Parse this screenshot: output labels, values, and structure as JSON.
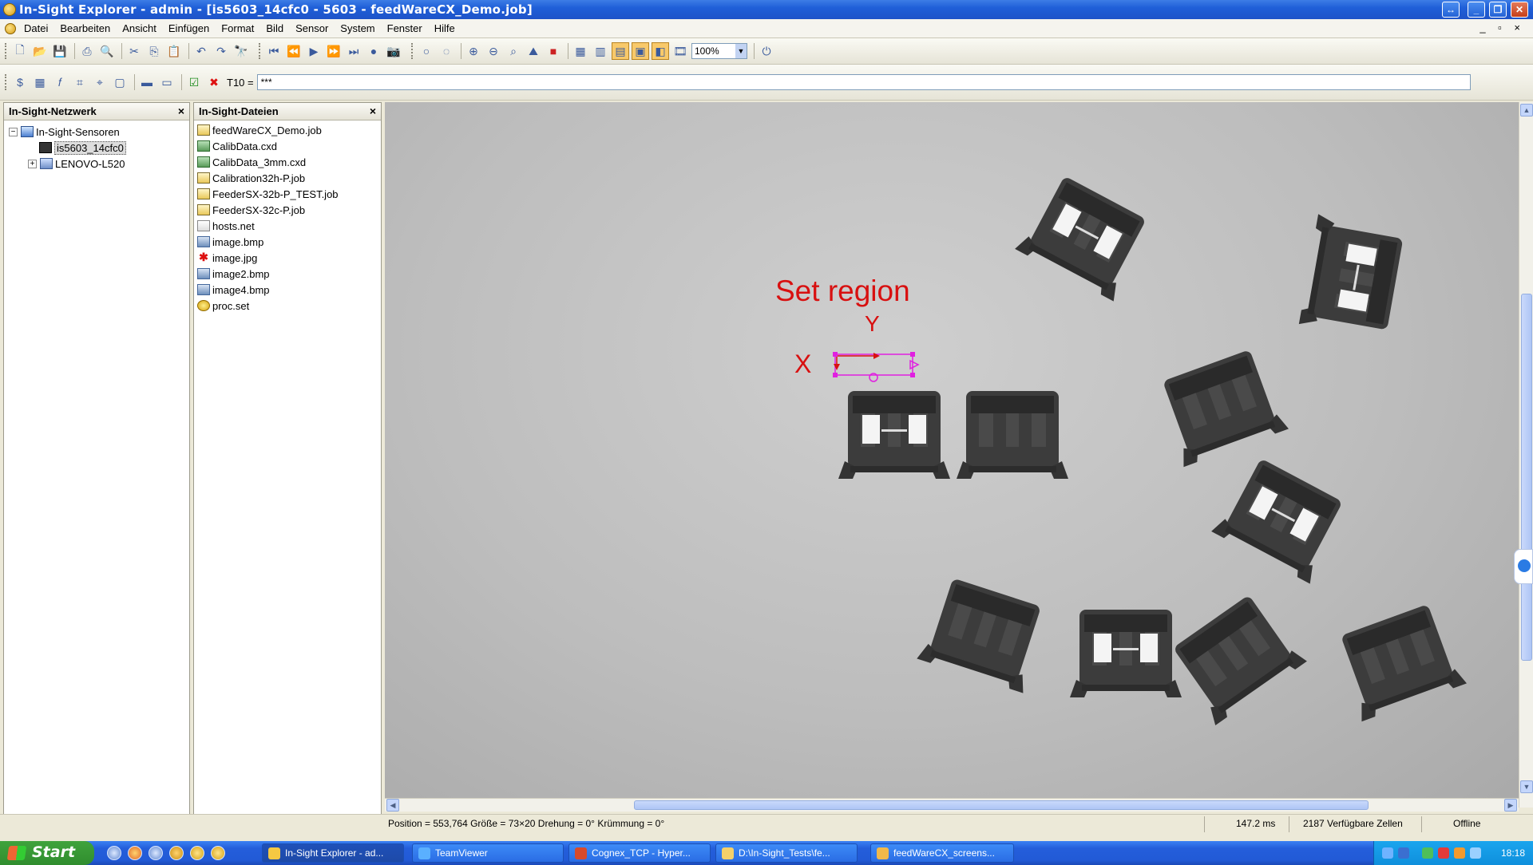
{
  "window": {
    "title": "In-Sight Explorer - admin - [is5603_14cfc0 - 5603 - feedWareCX_Demo.job]"
  },
  "menu": {
    "items": [
      "Datei",
      "Bearbeiten",
      "Ansicht",
      "Einfügen",
      "Format",
      "Bild",
      "Sensor",
      "System",
      "Fenster",
      "Hilfe"
    ],
    "mdi_controls": "_ ▫ ×"
  },
  "toolbar": {
    "zoom_value": "100%",
    "formula_label": "T10 =",
    "formula_value": "***"
  },
  "network_panel": {
    "title": "In-Sight-Netzwerk",
    "root": "In-Sight-Sensoren",
    "children": [
      "is5603_14cfc0",
      "LENOVO-L520"
    ]
  },
  "files_panel": {
    "title": "In-Sight-Dateien",
    "files": [
      {
        "name": "feedWareCX_Demo.job",
        "icon": "job-file-icon"
      },
      {
        "name": "CalibData.cxd",
        "icon": "cxd-file-icon"
      },
      {
        "name": "CalibData_3mm.cxd",
        "icon": "cxd-file-icon"
      },
      {
        "name": "Calibration32h-P.job",
        "icon": "job-file-icon"
      },
      {
        "name": "FeederSX-32b-P_TEST.job",
        "icon": "job-file-icon"
      },
      {
        "name": "FeederSX-32c-P.job",
        "icon": "job-file-icon"
      },
      {
        "name": "hosts.net",
        "icon": "net-file-icon"
      },
      {
        "name": "image.bmp",
        "icon": "bmp-file-icon"
      },
      {
        "name": "image.jpg",
        "icon": "jpg-file-icon"
      },
      {
        "name": "image2.bmp",
        "icon": "bmp-file-icon"
      },
      {
        "name": "image4.bmp",
        "icon": "bmp-file-icon"
      },
      {
        "name": "proc.set",
        "icon": "set-file-icon"
      }
    ]
  },
  "viewer": {
    "annotation": "Set region",
    "axis_x": "X",
    "axis_y": "Y",
    "colors": {
      "annotation": "#d81010",
      "region": "#e020e0"
    }
  },
  "status": {
    "position_text": "Position = 553,764 Größe = 73×20 Drehung = 0° Krümmung = 0°",
    "time": "147.2 ms",
    "cells": "2187 Verfügbare Zellen",
    "mode": "Offline"
  },
  "taskbar": {
    "start": "Start",
    "tasks": [
      "In-Sight Explorer - ad...",
      "TeamViewer",
      "Cognex_TCP - Hyper...",
      "D:\\In-Sight_Tests\\fe...",
      "feedWareCX_screens..."
    ],
    "clock": "18:18"
  }
}
